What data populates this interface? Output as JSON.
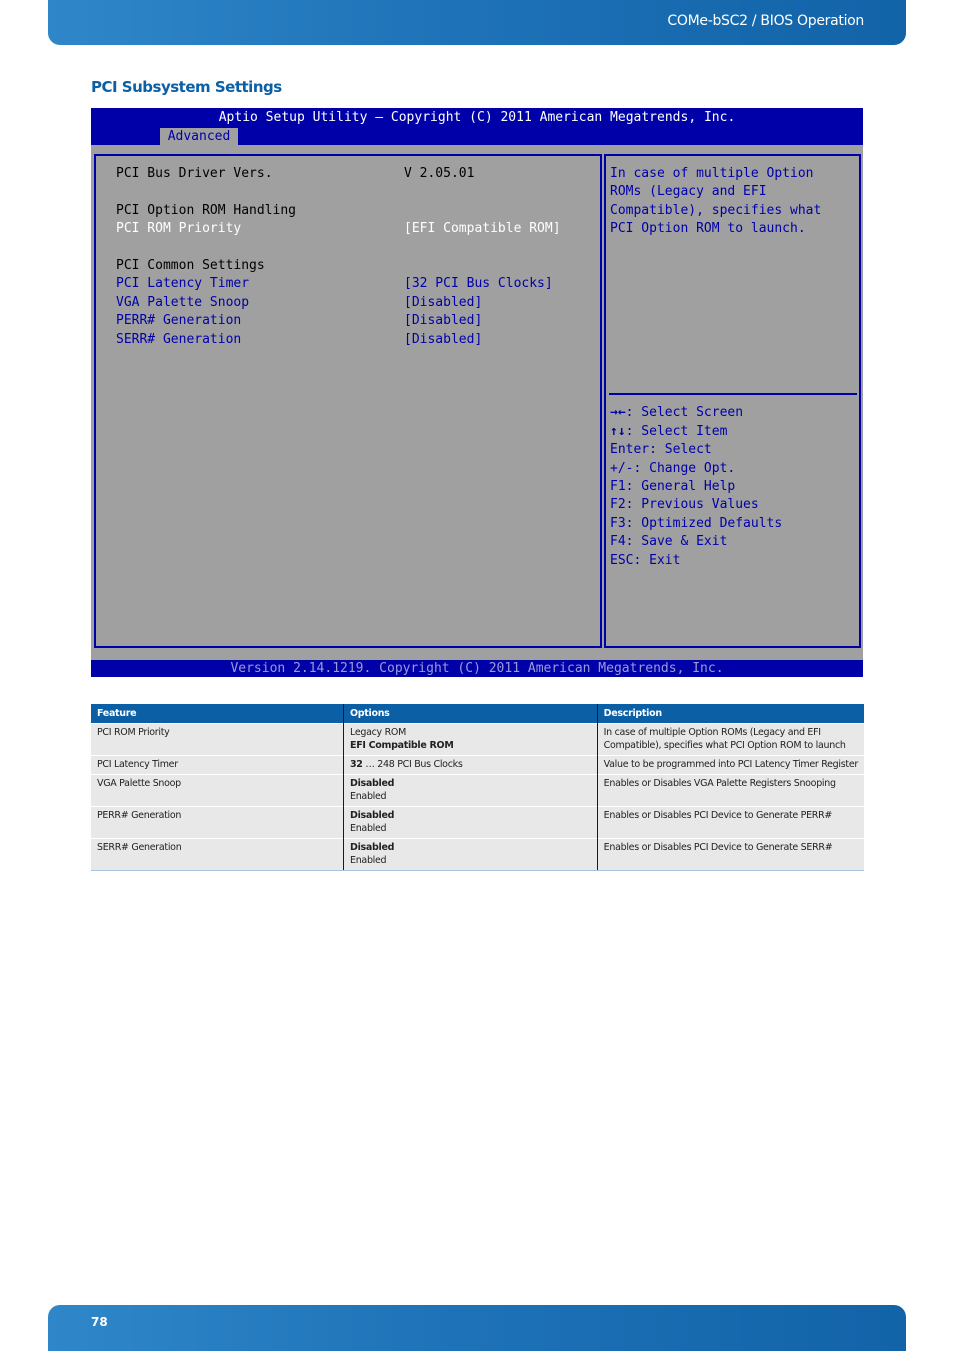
{
  "header": {
    "title": "COMe-bSC2 / BIOS Operation"
  },
  "section": {
    "title": "PCI Subsystem Settings"
  },
  "bios": {
    "title": "Aptio Setup Utility – Copyright (C) 2011 American Megatrends, Inc.",
    "active_tab": "Advanced",
    "items": [
      {
        "label": "PCI Bus Driver Vers.",
        "value": "V 2.05.01",
        "state": "info"
      },
      {
        "label": "PCI Option ROM Handling",
        "value": "",
        "state": "heading"
      },
      {
        "label": "PCI ROM Priority",
        "value": "[EFI Compatible ROM]",
        "state": "selected"
      },
      {
        "label": "PCI Common Settings",
        "value": "",
        "state": "heading"
      },
      {
        "label": "PCI Latency Timer",
        "value": "[32 PCI Bus Clocks]",
        "state": "option"
      },
      {
        "label": "VGA Palette Snoop",
        "value": "[Disabled]",
        "state": "option"
      },
      {
        "label": "PERR# Generation",
        "value": "[Disabled]",
        "state": "option"
      },
      {
        "label": "SERR# Generation",
        "value": "[Disabled]",
        "state": "option"
      }
    ],
    "help_lines": [
      "In case of multiple Option",
      "ROMs (Legacy and EFI",
      "Compatible), specifies what",
      "PCI Option ROM to launch."
    ],
    "keys": [
      {
        "key": "→←",
        "text": ": Select Screen"
      },
      {
        "key": "↑↓",
        "text": ": Select Item"
      },
      {
        "key": "",
        "text": "Enter: Select"
      },
      {
        "key": "",
        "text": "+/-: Change Opt."
      },
      {
        "key": "",
        "text": "F1: General Help"
      },
      {
        "key": "",
        "text": "F2: Previous Values"
      },
      {
        "key": "",
        "text": "F3: Optimized Defaults"
      },
      {
        "key": "",
        "text": "F4: Save & Exit"
      },
      {
        "key": "",
        "text": "ESC: Exit"
      }
    ],
    "footer": "Version 2.14.1219. Copyright (C) 2011 American Megatrends, Inc."
  },
  "table": {
    "headers": [
      "Feature",
      "Options",
      "Description"
    ],
    "rows": [
      {
        "feature": "PCI ROM Priority",
        "options": [
          {
            "text": "Legacy ROM",
            "default": false
          },
          {
            "text": "EFI Compatible ROM",
            "default": true
          }
        ],
        "description": "In case of multiple Option ROMs (Legacy and EFI Compatible), specifies what PCI Option ROM to launch"
      },
      {
        "feature": "PCI Latency Timer",
        "options_bold": "32",
        "options_rest": " … 248 PCI Bus Clocks",
        "description": "Value to be programmed into PCI Latency Timer Register"
      },
      {
        "feature": "VGA Palette Snoop",
        "options": [
          {
            "text": "Disabled",
            "default": true
          },
          {
            "text": "Enabled",
            "default": false
          }
        ],
        "description": "Enables or Disables VGA Palette Registers Snooping"
      },
      {
        "feature": "PERR# Generation",
        "options": [
          {
            "text": "Disabled",
            "default": true
          },
          {
            "text": "Enabled",
            "default": false
          }
        ],
        "description": "Enables or Disables PCI Device to Generate PERR#"
      },
      {
        "feature": "SERR# Generation",
        "options": [
          {
            "text": "Disabled",
            "default": true
          },
          {
            "text": "Enabled",
            "default": false
          }
        ],
        "description": "Enables or Disables PCI Device to Generate SERR#"
      }
    ]
  },
  "footer": {
    "page_number": "78"
  }
}
